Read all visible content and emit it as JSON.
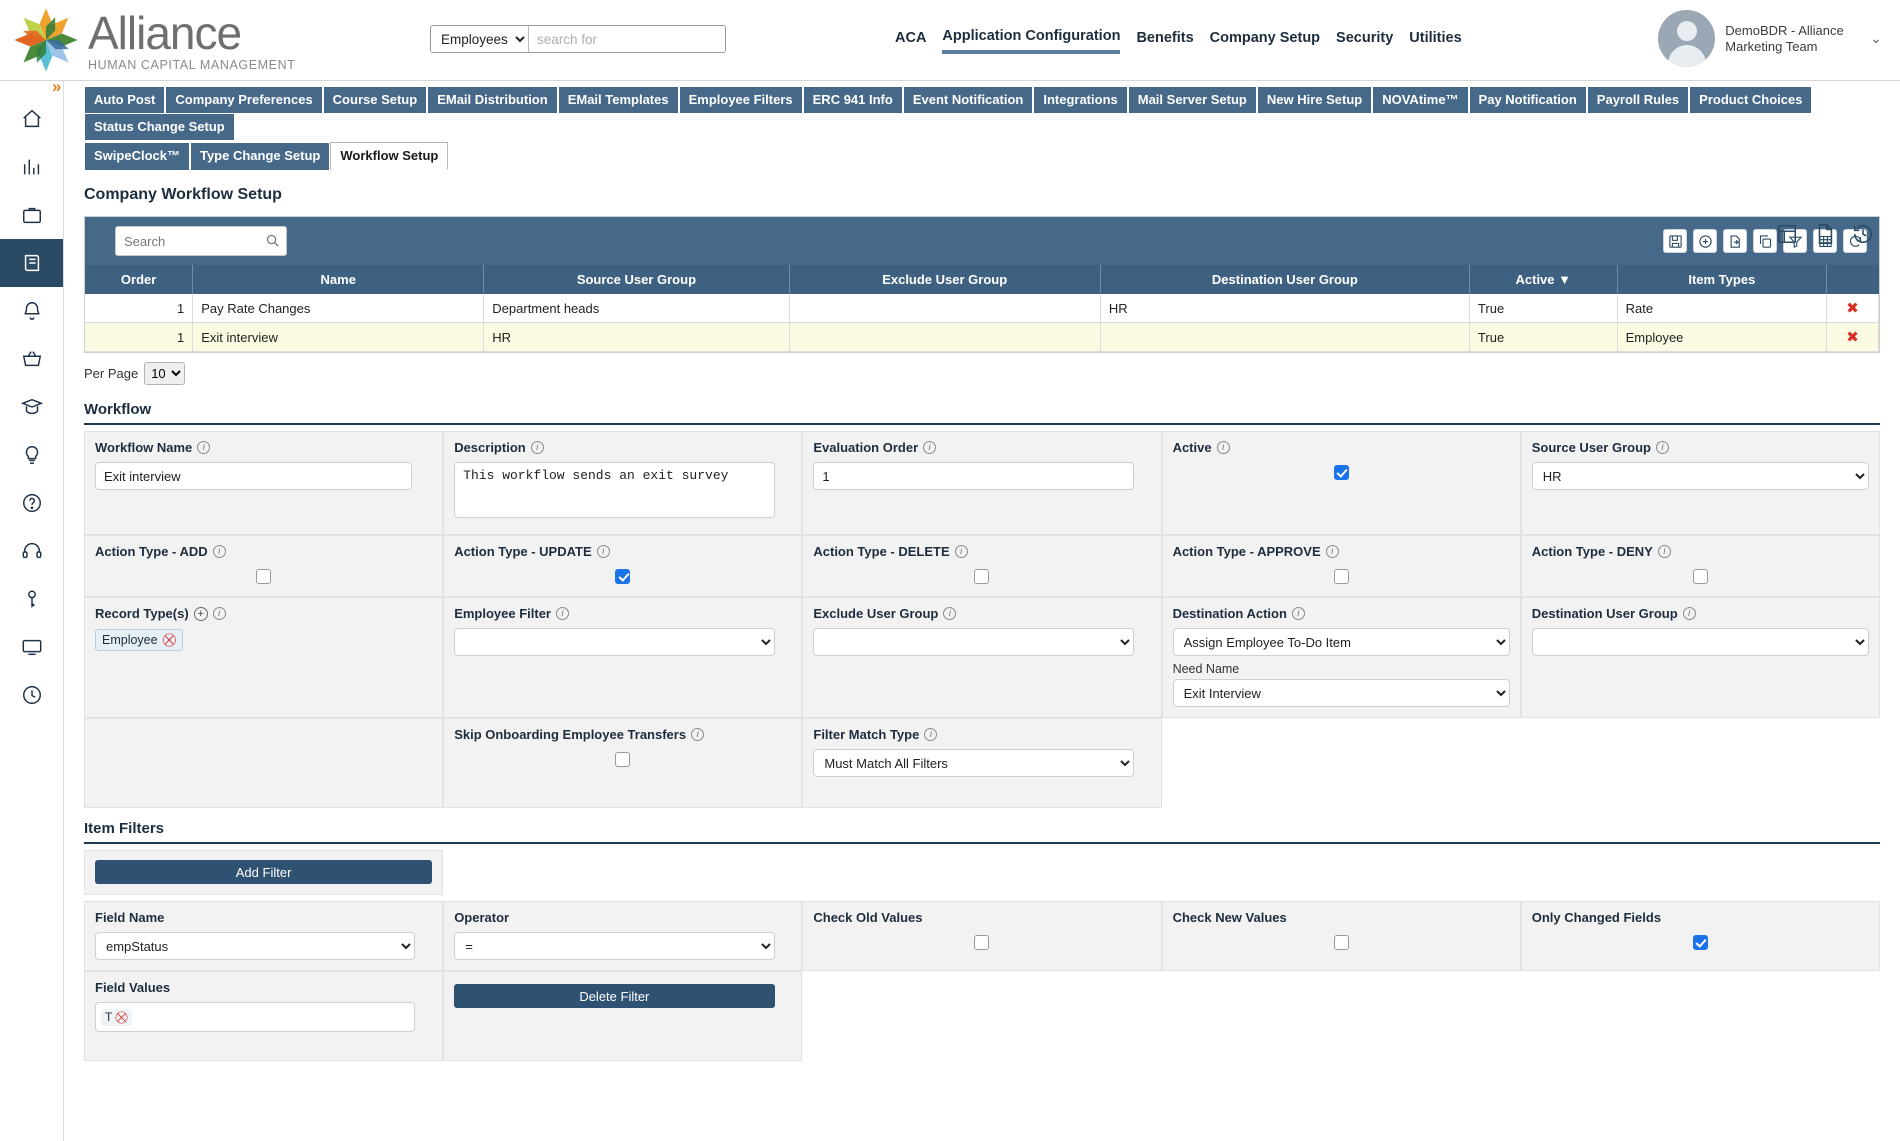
{
  "header": {
    "logo_title": "Alliance",
    "logo_subtitle": "HUMAN CAPITAL MANAGEMENT",
    "search_scope_value": "Employees",
    "search_placeholder": "search for",
    "search_value": "",
    "nav": [
      {
        "label": "ACA",
        "active": false
      },
      {
        "label": "Application Configuration",
        "active": true
      },
      {
        "label": "Benefits",
        "active": false
      },
      {
        "label": "Company Setup",
        "active": false
      },
      {
        "label": "Security",
        "active": false
      },
      {
        "label": "Utilities",
        "active": false
      }
    ],
    "user_name": "DemoBDR - Alliance Marketing Team",
    "user_caret": "⌄"
  },
  "sidebar": {
    "expand_glyph": "»",
    "items": [
      {
        "name": "home-icon",
        "active": false
      },
      {
        "name": "analytics-icon",
        "active": false
      },
      {
        "name": "briefcase-icon",
        "active": false
      },
      {
        "name": "book-icon",
        "active": true
      },
      {
        "name": "bell-icon",
        "active": false
      },
      {
        "name": "basket-icon",
        "active": false
      },
      {
        "name": "graduation-icon",
        "active": false
      },
      {
        "name": "lightbulb-icon",
        "active": false
      },
      {
        "name": "help-icon",
        "active": false
      },
      {
        "name": "headset-icon",
        "active": false
      },
      {
        "name": "key-icon",
        "active": false
      },
      {
        "name": "monitor-icon",
        "active": false
      },
      {
        "name": "clock-icon",
        "active": false
      }
    ]
  },
  "tabs_row1": [
    {
      "label": "Auto Post",
      "selected": false
    },
    {
      "label": "Company Preferences",
      "selected": false
    },
    {
      "label": "Course Setup",
      "selected": false
    },
    {
      "label": "EMail Distribution",
      "selected": false
    },
    {
      "label": "EMail Templates",
      "selected": false
    },
    {
      "label": "Employee Filters",
      "selected": false
    },
    {
      "label": "ERC 941 Info",
      "selected": false
    },
    {
      "label": "Event Notification",
      "selected": false
    },
    {
      "label": "Integrations",
      "selected": false
    },
    {
      "label": "Mail Server Setup",
      "selected": false
    },
    {
      "label": "New Hire Setup",
      "selected": false
    },
    {
      "label": "NOVAtime™",
      "selected": false
    },
    {
      "label": "Pay Notification",
      "selected": false
    },
    {
      "label": "Payroll Rules",
      "selected": false
    },
    {
      "label": "Product Choices",
      "selected": false
    },
    {
      "label": "Status Change Setup",
      "selected": false
    }
  ],
  "tabs_row2": [
    {
      "label": "SwipeClock™",
      "selected": false
    },
    {
      "label": "Type Change Setup",
      "selected": false
    },
    {
      "label": "Workflow Setup",
      "selected": true
    }
  ],
  "page": {
    "title": "Company Workflow Setup"
  },
  "grid": {
    "search_placeholder": "Search",
    "search_value": "",
    "columns": [
      "Order",
      "Name",
      "Source User Group",
      "Exclude User Group",
      "Destination User Group",
      "Active ▼",
      "Item Types",
      ""
    ],
    "rows": [
      {
        "order": "1",
        "name": "Pay Rate Changes",
        "source_user_group": "Department heads",
        "exclude_user_group": "",
        "destination_user_group": "HR",
        "active": "True",
        "item_types": "Rate",
        "highlighted": false
      },
      {
        "order": "1",
        "name": "Exit interview",
        "source_user_group": "HR",
        "exclude_user_group": "",
        "destination_user_group": "",
        "active": "True",
        "item_types": "Employee",
        "highlighted": true
      }
    ],
    "per_page_label": "Per Page",
    "per_page_value": "10"
  },
  "workflow_section": {
    "title": "Workflow",
    "fields": {
      "workflow_name_label": "Workflow Name",
      "workflow_name_value": "Exit interview",
      "description_label": "Description",
      "description_value": "This workflow sends an exit survey",
      "evaluation_order_label": "Evaluation Order",
      "evaluation_order_value": "1",
      "active_label": "Active",
      "active_checked": true,
      "source_user_group_label": "Source User Group",
      "source_user_group_value": "HR",
      "action_add_label": "Action Type - ADD",
      "action_add_checked": false,
      "action_update_label": "Action Type - UPDATE",
      "action_update_checked": true,
      "action_delete_label": "Action Type - DELETE",
      "action_delete_checked": false,
      "action_approve_label": "Action Type - APPROVE",
      "action_approve_checked": false,
      "action_deny_label": "Action Type - DENY",
      "action_deny_checked": false,
      "record_types_label": "Record Type(s)",
      "record_type_chip": "Employee",
      "employee_filter_label": "Employee Filter",
      "employee_filter_value": "",
      "exclude_user_group_label": "Exclude User Group",
      "exclude_user_group_value": "",
      "destination_action_label": "Destination Action",
      "destination_action_value": "Assign Employee To-Do Item",
      "need_name_label": "Need Name",
      "need_name_value": "Exit Interview",
      "destination_user_group_label": "Destination User Group",
      "destination_user_group_value": "",
      "skip_onboarding_label": "Skip Onboarding Employee Transfers",
      "skip_onboarding_checked": false,
      "filter_match_type_label": "Filter Match Type",
      "filter_match_type_value": "Must Match All Filters"
    }
  },
  "item_filters_section": {
    "title": "Item Filters",
    "add_filter_label": "Add Filter",
    "delete_filter_label": "Delete Filter",
    "field_name_label": "Field Name",
    "field_name_value": "empStatus",
    "operator_label": "Operator",
    "operator_value": "=",
    "check_old_values_label": "Check Old Values",
    "check_old_values_checked": false,
    "check_new_values_label": "Check New Values",
    "check_new_values_checked": false,
    "only_changed_fields_label": "Only Changed Fields",
    "only_changed_fields_checked": true,
    "field_values_label": "Field Values",
    "field_values_chip": "T"
  },
  "colors": {
    "brand_blue": "#2b4a63",
    "tab_blue": "#46698a",
    "accent_orange": "#e8821e",
    "checkbox_blue": "#1a73e8",
    "highlight_row": "#fbfbe3"
  }
}
